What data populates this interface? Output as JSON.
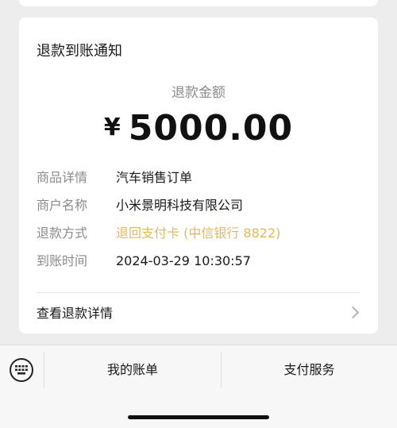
{
  "card": {
    "title": "退款到账通知",
    "amount_label": "退款金额",
    "currency": "¥",
    "amount": "5000.00",
    "details": [
      {
        "key": "商品详情",
        "value": "汽车销售订单"
      },
      {
        "key": "商户名称",
        "value": "小米景明科技有限公司"
      },
      {
        "key": "退款方式",
        "value": "退回支付卡 (中信银行 8822)"
      },
      {
        "key": "到账时间",
        "value": "2024-03-29 10:30:57"
      }
    ],
    "view_details": "查看退款详情"
  },
  "bottom_menu": {
    "items": [
      "我的账单",
      "支付服务"
    ]
  },
  "colors": {
    "accent": "#e3b863",
    "background": "#ededed",
    "card": "#ffffff"
  },
  "icons": {
    "keyboard": "keyboard-icon",
    "chevron": "chevron-right-icon"
  }
}
